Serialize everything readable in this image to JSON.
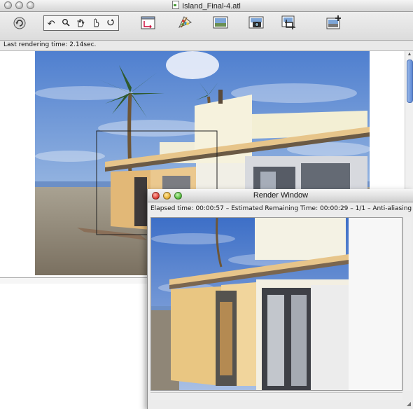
{
  "main_window": {
    "title": "Island_Final-4.atl",
    "status": "Last rendering time: 2.14sec."
  },
  "toolbar": {
    "icons": [
      "refresh-icon",
      "undo-icon",
      "zoom-icon",
      "pan-hand-icon",
      "select-hand-icon",
      "rotate-icon",
      "axes-icon",
      "palette-icon",
      "background-image-icon",
      "camera-icon",
      "crop-render-icon",
      "add-image-icon"
    ]
  },
  "render_window": {
    "title": "Render Window",
    "status": "Elapsed time: 00:00:57  –  Estimated Remaining Time: 00:00:29  –    1/1  –  Anti-aliasing  –"
  },
  "colors": {
    "sky": "#7fa6dc",
    "sand": "#8c8274",
    "wall_yellow": "#e8c98c",
    "wall_white": "#f4f2e4",
    "close": "#e0443b",
    "minimize": "#e8b43a",
    "zoom": "#5bbf43"
  }
}
